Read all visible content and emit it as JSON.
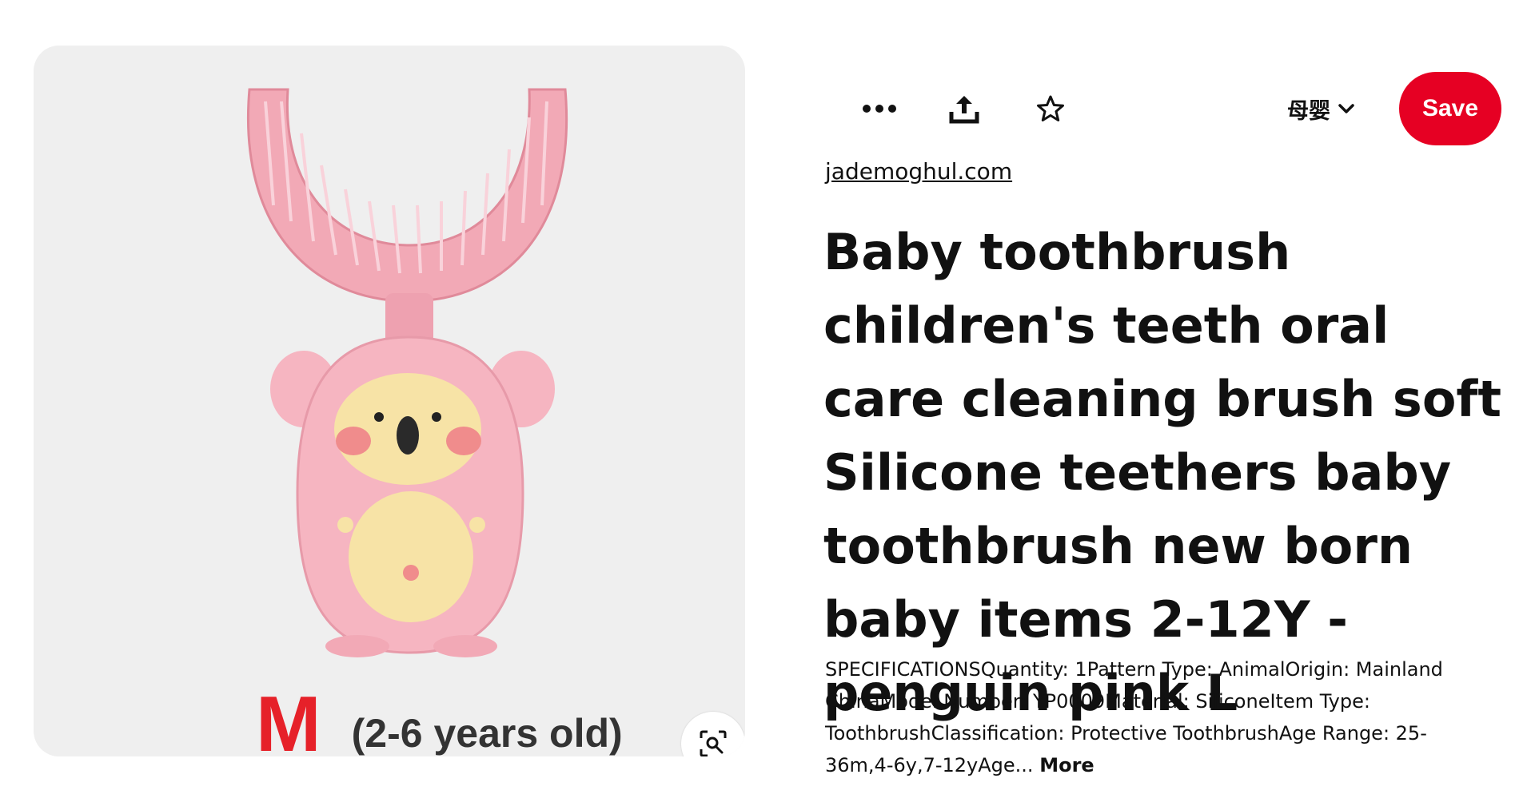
{
  "image": {
    "size_letter": "M",
    "size_range": "(2-6 years old)",
    "colors": {
      "card_bg": "#efefef",
      "brush_pink": "#f2a9b6",
      "body_pink": "#f6b5c1",
      "face_yellow": "#f7e3a6",
      "size_red": "#e62129"
    }
  },
  "toolbar": {
    "more_icon": "more-horizontal-icon",
    "share_icon": "share-upload-icon",
    "favorite_icon": "star-outline-icon",
    "board_name": "母婴",
    "board_chevron": "chevron-down-icon",
    "save_label": "Save",
    "save_color": "#e60023"
  },
  "pin": {
    "source": "jademoghul.com",
    "title": "Baby toothbrush children's teeth oral care cleaning brush soft Silicone teethers baby toothbrush new born baby items 2-12Y - penguin pink L",
    "description": "SPECIFICATIONSQuantity: 1Pattern Type: AnimalOrigin: Mainland ChinaModel Number: YP0009Material: SiliconeItem Type: ToothbrushClassification: Protective ToothbrushAge Range: 25-36m,4-6y,7-12yAge...",
    "more_label": "More"
  }
}
